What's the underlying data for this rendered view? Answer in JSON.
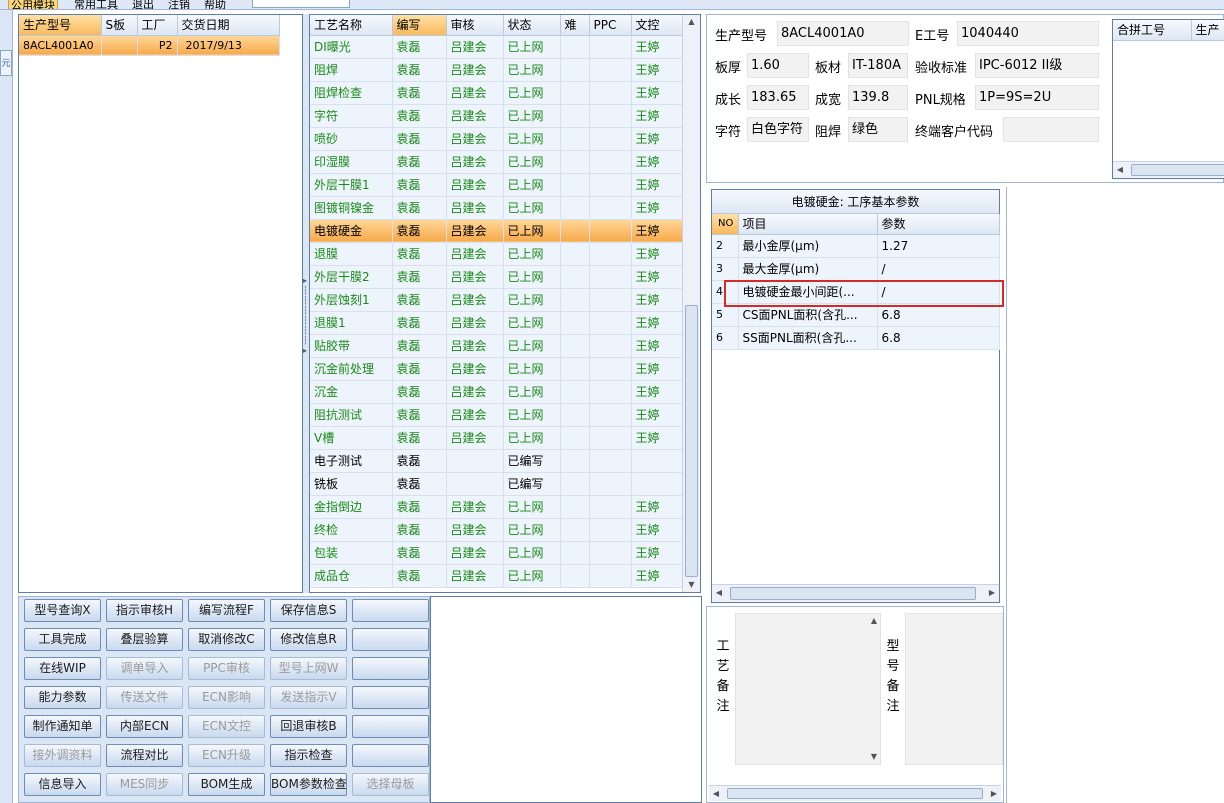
{
  "menubar": {
    "items": [
      "公用模块",
      "常用工具",
      "退出",
      "注销",
      "帮助"
    ]
  },
  "left_strip": {
    "tab_label": "元"
  },
  "models": {
    "columns": [
      "生产型号",
      "S板",
      "工厂",
      "交货日期"
    ],
    "rows": [
      {
        "model": "8ACL4001A0",
        "s_board": "",
        "factory": "P2",
        "date": "2017/9/13"
      }
    ]
  },
  "process": {
    "columns": [
      "工艺名称",
      "编写",
      "审核",
      "状态",
      "难",
      "PPC",
      "文控"
    ],
    "rows": [
      {
        "name": "DI曝光",
        "writer": "袁磊",
        "reviewer": "吕建会",
        "status": "已上网",
        "difficulty": "",
        "ppc": "",
        "doc": "王婷"
      },
      {
        "name": "阻焊",
        "writer": "袁磊",
        "reviewer": "吕建会",
        "status": "已上网",
        "difficulty": "",
        "ppc": "",
        "doc": "王婷"
      },
      {
        "name": "阻焊检查",
        "writer": "袁磊",
        "reviewer": "吕建会",
        "status": "已上网",
        "difficulty": "",
        "ppc": "",
        "doc": "王婷"
      },
      {
        "name": "字符",
        "writer": "袁磊",
        "reviewer": "吕建会",
        "status": "已上网",
        "difficulty": "",
        "ppc": "",
        "doc": "王婷"
      },
      {
        "name": "喷砂",
        "writer": "袁磊",
        "reviewer": "吕建会",
        "status": "已上网",
        "difficulty": "",
        "ppc": "",
        "doc": "王婷"
      },
      {
        "name": "印湿膜",
        "writer": "袁磊",
        "reviewer": "吕建会",
        "status": "已上网",
        "difficulty": "",
        "ppc": "",
        "doc": "王婷"
      },
      {
        "name": "外层干膜1",
        "writer": "袁磊",
        "reviewer": "吕建会",
        "status": "已上网",
        "difficulty": "",
        "ppc": "",
        "doc": "王婷"
      },
      {
        "name": "图镀铜镍金",
        "writer": "袁磊",
        "reviewer": "吕建会",
        "status": "已上网",
        "difficulty": "",
        "ppc": "",
        "doc": "王婷"
      },
      {
        "name": "电镀硬金",
        "writer": "袁磊",
        "reviewer": "吕建会",
        "status": "已上网",
        "difficulty": "",
        "ppc": "",
        "doc": "王婷"
      },
      {
        "name": "退膜",
        "writer": "袁磊",
        "reviewer": "吕建会",
        "status": "已上网",
        "difficulty": "",
        "ppc": "",
        "doc": "王婷"
      },
      {
        "name": "外层干膜2",
        "writer": "袁磊",
        "reviewer": "吕建会",
        "status": "已上网",
        "difficulty": "",
        "ppc": "",
        "doc": "王婷"
      },
      {
        "name": "外层蚀刻1",
        "writer": "袁磊",
        "reviewer": "吕建会",
        "status": "已上网",
        "difficulty": "",
        "ppc": "",
        "doc": "王婷"
      },
      {
        "name": "退膜1",
        "writer": "袁磊",
        "reviewer": "吕建会",
        "status": "已上网",
        "difficulty": "",
        "ppc": "",
        "doc": "王婷"
      },
      {
        "name": "贴胶带",
        "writer": "袁磊",
        "reviewer": "吕建会",
        "status": "已上网",
        "difficulty": "",
        "ppc": "",
        "doc": "王婷"
      },
      {
        "name": "沉金前处理",
        "writer": "袁磊",
        "reviewer": "吕建会",
        "status": "已上网",
        "difficulty": "",
        "ppc": "",
        "doc": "王婷"
      },
      {
        "name": "沉金",
        "writer": "袁磊",
        "reviewer": "吕建会",
        "status": "已上网",
        "difficulty": "",
        "ppc": "",
        "doc": "王婷"
      },
      {
        "name": "阻抗测试",
        "writer": "袁磊",
        "reviewer": "吕建会",
        "status": "已上网",
        "difficulty": "",
        "ppc": "",
        "doc": "王婷"
      },
      {
        "name": "V槽",
        "writer": "袁磊",
        "reviewer": "吕建会",
        "status": "已上网",
        "difficulty": "",
        "ppc": "",
        "doc": "王婷"
      },
      {
        "name": "电子测试",
        "writer": "袁磊",
        "reviewer": "",
        "status": "已编写",
        "difficulty": "",
        "ppc": "",
        "doc": ""
      },
      {
        "name": "铣板",
        "writer": "袁磊",
        "reviewer": "",
        "status": "已编写",
        "difficulty": "",
        "ppc": "",
        "doc": ""
      },
      {
        "name": "金指倒边",
        "writer": "袁磊",
        "reviewer": "吕建会",
        "status": "已上网",
        "difficulty": "",
        "ppc": "",
        "doc": "王婷"
      },
      {
        "name": "终检",
        "writer": "袁磊",
        "reviewer": "吕建会",
        "status": "已上网",
        "difficulty": "",
        "ppc": "",
        "doc": "王婷"
      },
      {
        "name": "包装",
        "writer": "袁磊",
        "reviewer": "吕建会",
        "status": "已上网",
        "difficulty": "",
        "ppc": "",
        "doc": "王婷"
      },
      {
        "name": "成品仓",
        "writer": "袁磊",
        "reviewer": "吕建会",
        "status": "已上网",
        "difficulty": "",
        "ppc": "",
        "doc": "王婷"
      }
    ]
  },
  "info": {
    "model_label": "生产型号",
    "model_value": "8ACL4001A0",
    "eno_label": "E工号",
    "eno_value": "1040440",
    "thickness_label": "板厚",
    "thickness_value": "1.60",
    "material_label": "板材",
    "material_value": "IT-180A",
    "standard_label": "验收标准",
    "standard_value": "IPC-6012 II级",
    "length_label": "成长",
    "length_value": "183.65",
    "width_label": "成宽",
    "width_value": "139.8",
    "pnl_label": "PNL规格",
    "pnl_value": "1P=9S=2U",
    "char_label": "字符",
    "char_value": "白色字符",
    "mask_label": "阻焊",
    "mask_value": "绿色",
    "customer_label": "终端客户代码",
    "customer_value": ""
  },
  "merge": {
    "columns": [
      "合拼工号",
      "生产"
    ]
  },
  "params": {
    "title": "电镀硬金: 工序基本参数",
    "columns": [
      "NO",
      "项目",
      "参数"
    ],
    "rows": [
      {
        "no": "2",
        "item": "最小金厚(μm)",
        "value": "1.27"
      },
      {
        "no": "3",
        "item": "最大金厚(μm)",
        "value": "/"
      },
      {
        "no": "4",
        "item": "电镀硬金最小间距(...",
        "value": "/"
      },
      {
        "no": "5",
        "item": "CS面PNL面积(含孔...",
        "value": "6.8"
      },
      {
        "no": "6",
        "item": "SS面PNL面积(含孔...",
        "value": "6.8"
      }
    ]
  },
  "remarks": {
    "process_label": [
      "工",
      "艺",
      "备",
      "注"
    ],
    "model_label": [
      "型",
      "号",
      "备",
      "注"
    ]
  },
  "buttons": [
    {
      "label": "型号查询X",
      "enabled": true
    },
    {
      "label": "指示审核H",
      "enabled": true
    },
    {
      "label": "编写流程F",
      "enabled": true
    },
    {
      "label": "保存信息S",
      "enabled": true
    },
    {
      "label": "",
      "enabled": true
    },
    {
      "label": "工具完成",
      "enabled": true
    },
    {
      "label": "叠层验算",
      "enabled": true
    },
    {
      "label": "取消修改C",
      "enabled": true
    },
    {
      "label": "修改信息R",
      "enabled": true
    },
    {
      "label": "",
      "enabled": true
    },
    {
      "label": "在线WIP",
      "enabled": true
    },
    {
      "label": "调单导入",
      "enabled": false
    },
    {
      "label": "PPC审核",
      "enabled": false
    },
    {
      "label": "型号上网W",
      "enabled": false
    },
    {
      "label": "",
      "enabled": true
    },
    {
      "label": "能力参数",
      "enabled": true
    },
    {
      "label": "传送文件",
      "enabled": false
    },
    {
      "label": "ECN影响",
      "enabled": false
    },
    {
      "label": "发送指示V",
      "enabled": false
    },
    {
      "label": "",
      "enabled": true
    },
    {
      "label": "制作通知单",
      "enabled": true
    },
    {
      "label": "内部ECN",
      "enabled": true
    },
    {
      "label": "ECN文控",
      "enabled": false
    },
    {
      "label": "回退审核B",
      "enabled": true
    },
    {
      "label": "",
      "enabled": true
    },
    {
      "label": "接外调资料",
      "enabled": false
    },
    {
      "label": "流程对比",
      "enabled": true
    },
    {
      "label": "ECN升级",
      "enabled": false
    },
    {
      "label": "指示检查",
      "enabled": true
    },
    {
      "label": "",
      "enabled": true
    },
    {
      "label": "信息导入",
      "enabled": true
    },
    {
      "label": "MES同步",
      "enabled": false
    },
    {
      "label": "BOM生成",
      "enabled": true
    },
    {
      "label": "BOM参数检查",
      "enabled": true
    },
    {
      "label": "选择母板",
      "enabled": false
    }
  ],
  "selected": {
    "model_row": 0,
    "process_row": 8
  },
  "colors": {
    "approved_green": "#1a8a1a",
    "selection_orange": "#f6a94a",
    "annotation_red": "#d42a2a",
    "header_blue": "#dde7f4"
  }
}
